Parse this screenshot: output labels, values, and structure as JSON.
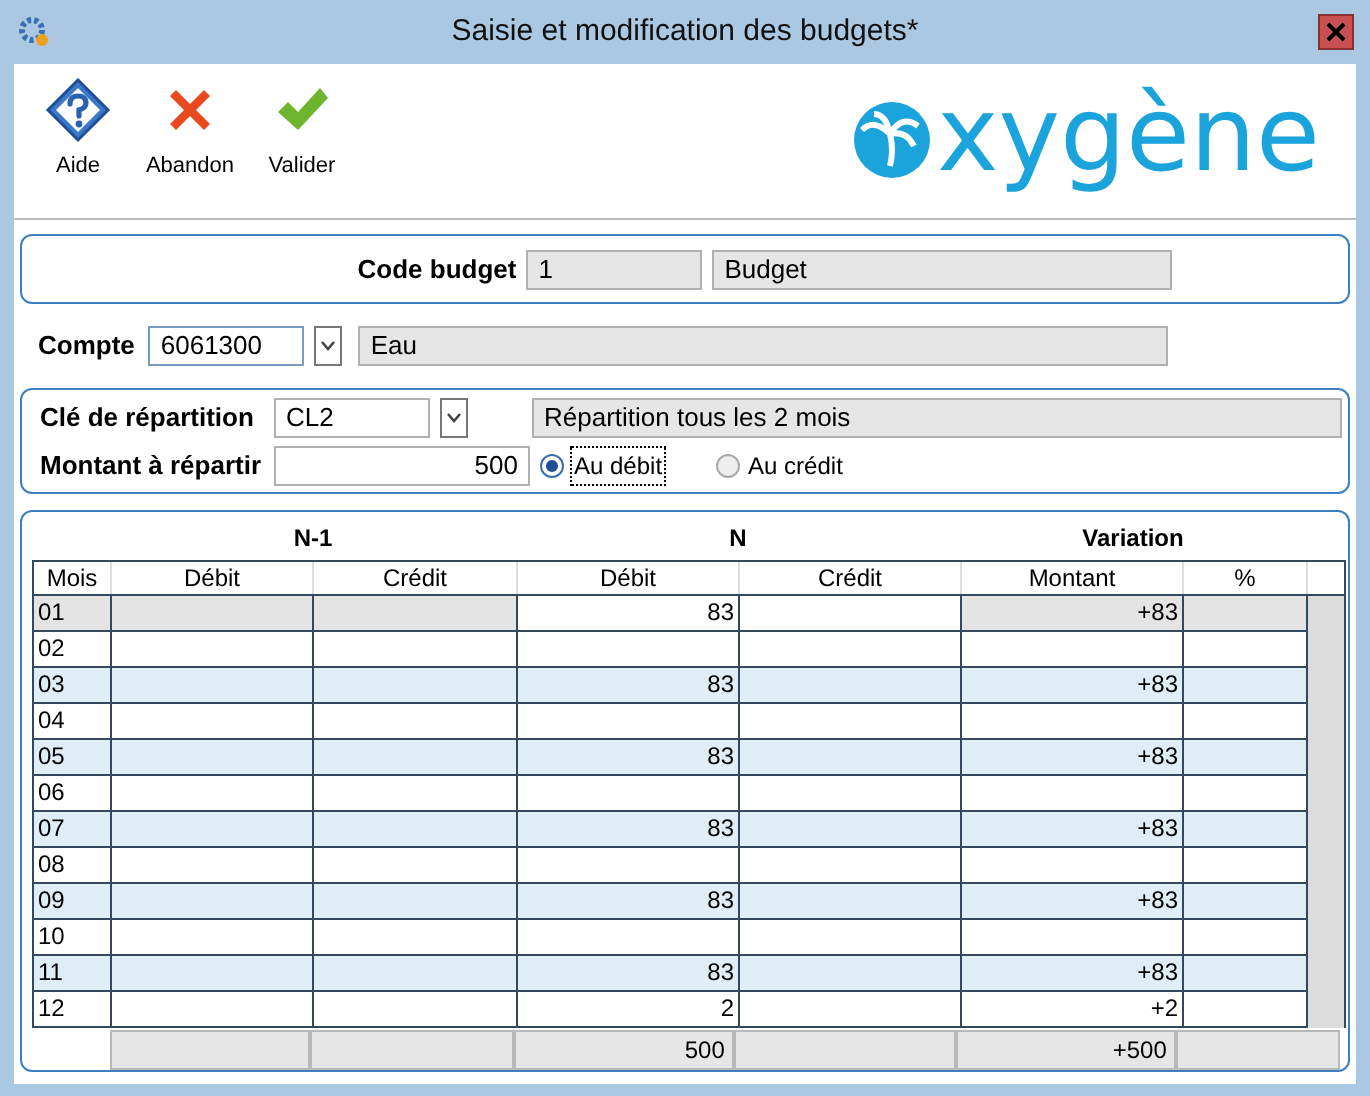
{
  "window": {
    "title": "Saisie et modification des budgets*"
  },
  "toolbar": [
    {
      "kind": "help",
      "label": "Aide"
    },
    {
      "kind": "cancel",
      "label": "Abandon"
    },
    {
      "kind": "ok",
      "label": "Valider"
    }
  ],
  "logo": {
    "text": "xygène"
  },
  "code_budget": {
    "label": "Code budget",
    "code": "1",
    "name": "Budget"
  },
  "compte": {
    "label": "Compte",
    "value": "6061300",
    "name": "Eau"
  },
  "repartition": {
    "label": "Clé de répartition",
    "value": "CL2",
    "name": "Répartition tous les 2 mois"
  },
  "montant": {
    "label": "Montant à répartir",
    "value": "500"
  },
  "sens": [
    {
      "label": "Au débit",
      "selected": true
    },
    {
      "label": "Au crédit",
      "selected": false
    }
  ],
  "table": {
    "groups": [
      "N-1",
      "N",
      "Variation"
    ],
    "columns": [
      "Mois",
      "Débit",
      "Crédit",
      "Débit",
      "Crédit",
      "Montant",
      "%"
    ],
    "rows": [
      {
        "mois": "01",
        "n_debit": "83",
        "montant": "+83",
        "selected": true
      },
      {
        "mois": "02",
        "selected": false
      },
      {
        "mois": "03",
        "n_debit": "83",
        "montant": "+83",
        "selected": false
      },
      {
        "mois": "04",
        "selected": false
      },
      {
        "mois": "05",
        "n_debit": "83",
        "montant": "+83",
        "selected": false
      },
      {
        "mois": "06",
        "selected": false
      },
      {
        "mois": "07",
        "n_debit": "83",
        "montant": "+83",
        "selected": false
      },
      {
        "mois": "08",
        "selected": false
      },
      {
        "mois": "09",
        "n_debit": "83",
        "montant": "+83",
        "selected": false
      },
      {
        "mois": "10",
        "selected": false
      },
      {
        "mois": "11",
        "n_debit": "83",
        "montant": "+83",
        "selected": false
      },
      {
        "mois": "12",
        "n_debit": "2",
        "montant": "+2",
        "selected": false
      }
    ],
    "totals": {
      "n_debit": "500",
      "montant": "+500"
    }
  }
}
